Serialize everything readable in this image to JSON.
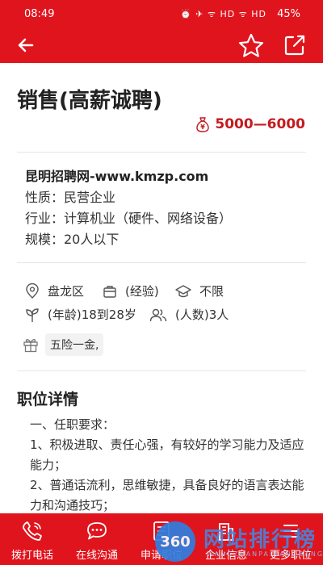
{
  "status_bar": {
    "time": "08:49",
    "indicators": "⏰ ✈ ᯤ HD ᯤ HD",
    "battery": "45%"
  },
  "app_bar": {
    "back_icon": "arrow-left-icon",
    "favorite_icon": "star-icon",
    "share_icon": "share-icon"
  },
  "job": {
    "title": "销售(高薪诚聘)",
    "salary": "5000—6000",
    "salary_icon": "money-bag-icon"
  },
  "company": {
    "name": "昆明招聘网-www.kmzp.com",
    "nature": "性质：民营企业",
    "industry": "行业：计算机业（硬件、网络设备）",
    "scale": "规模：20人以下"
  },
  "tags": {
    "location": "盘龙区",
    "experience": "(经验)",
    "education": "不限",
    "age": "(年龄)18到28岁",
    "headcount": "(人数)3人",
    "welfare": "五险一金,"
  },
  "details": {
    "section_title": "职位详情",
    "lines": [
      "一、任职要求：",
      "1、积极进取、责任心强，有较好的学习能力及适应",
      "能力；",
      "2、普通话流利，思维敏捷，具备良好的语言表达能",
      "力和沟通技巧；"
    ]
  },
  "tab_bar": {
    "call": "拨打电话",
    "chat": "在线沟通",
    "apply": "申请职位",
    "company_info": "企业信息",
    "more_jobs": "更多职位"
  },
  "watermark": {
    "badge": "360",
    "text": "网站排行榜",
    "sub": "WANGZHANPAIHANGBANG"
  },
  "colors": {
    "brand_red": "#e0141d",
    "salary_red": "#c41a1f"
  }
}
